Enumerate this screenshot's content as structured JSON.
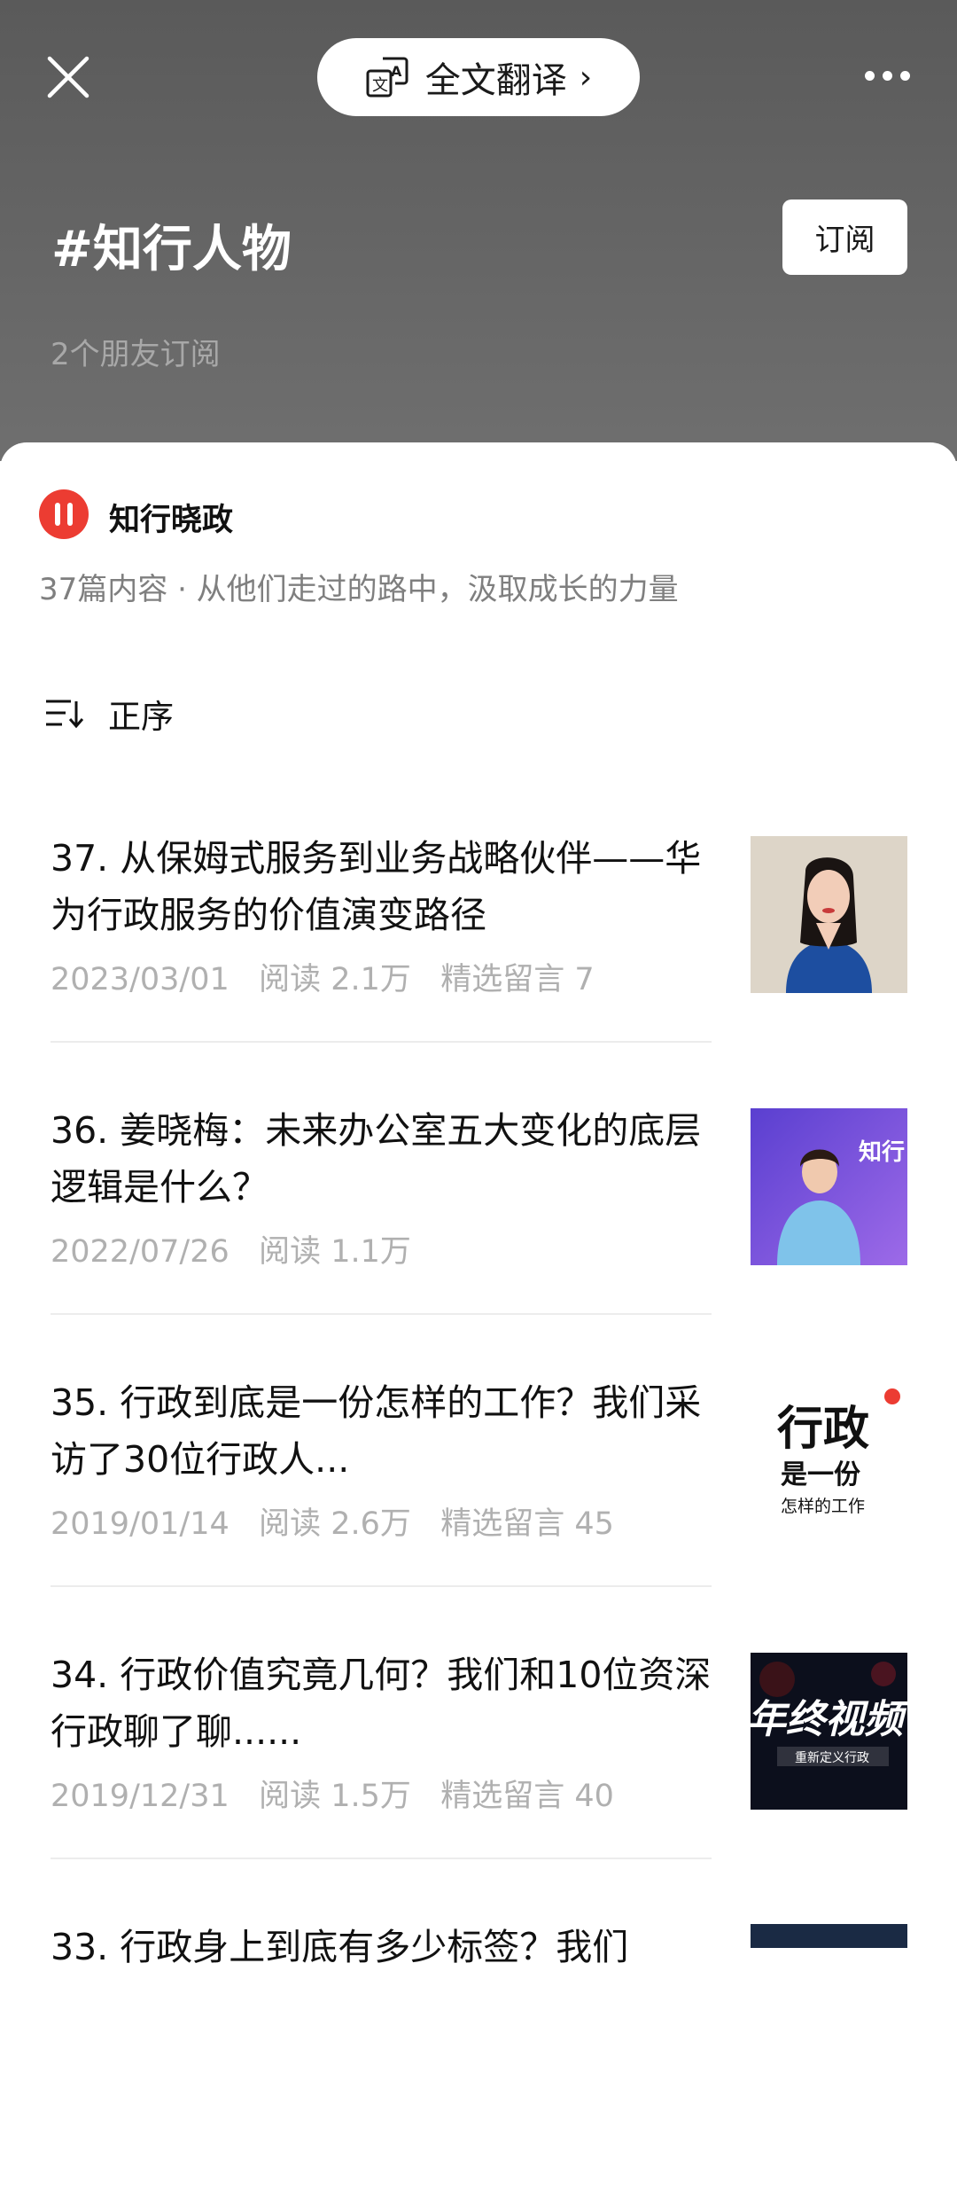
{
  "header": {
    "translate_label": "全文翻译",
    "translate_chevron": "›",
    "hashtag_title": "#知行人物",
    "subscribe_label": "订阅",
    "friends_subscribed": "2个朋友订阅",
    "icons": [
      "close-icon",
      "translate-icon",
      "more-icon"
    ]
  },
  "account": {
    "name": "知行晓政",
    "description": "37篇内容 · 从他们走过的路中，汲取成长的力量",
    "avatar_color": "#ec3c32"
  },
  "sort": {
    "label": "正序",
    "icon": "sort-icon"
  },
  "articles": [
    {
      "title": "37. 从保姆式服务到业务战略伙伴——华为行政服务的价值演变路径",
      "meta": "2023/03/01   阅读 2.1万   精选留言 7"
    },
    {
      "title": "36. 姜晓梅：未来办公室五大变化的底层逻辑是什么？",
      "meta": "2022/07/26   阅读 1.1万",
      "thumb_text": "知行"
    },
    {
      "title": "35. 行政到底是一份怎样的工作？我们采访了30位行政人...",
      "meta": "2019/01/14   阅读 2.6万   精选留言 45",
      "thumb_line1": "行政",
      "thumb_line2": "是一份",
      "thumb_line3": "怎样的工作"
    },
    {
      "title": "34. 行政价值究竟几何？我们和10位资深行政聊了聊......",
      "meta": "2019/12/31   阅读 1.5万   精选留言 40",
      "thumb_line1": "年终视频",
      "thumb_line2": "重新定义行政"
    },
    {
      "title": "33. 行政身上到底有多少标签？我们"
    }
  ],
  "colors": {
    "header_bg": "#5f5f5f",
    "accent_red": "#ec3c32"
  }
}
